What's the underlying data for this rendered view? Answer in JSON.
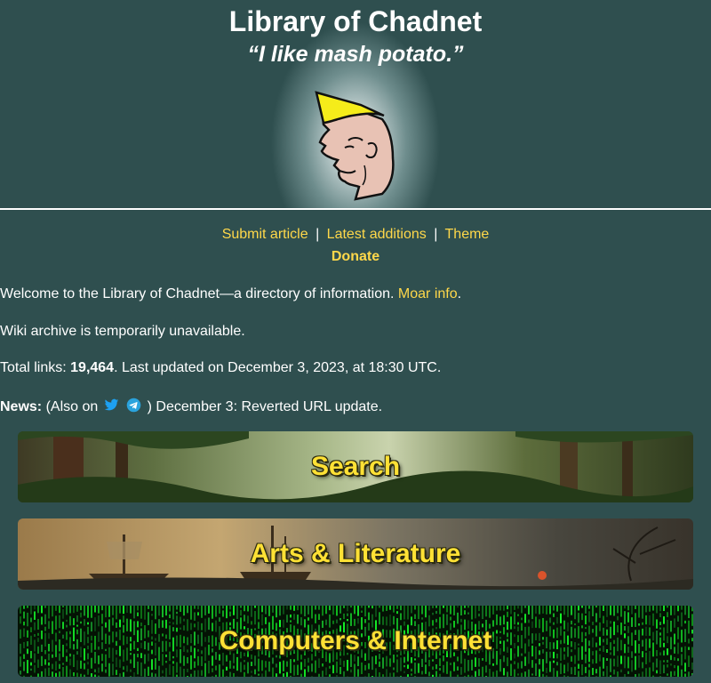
{
  "header": {
    "title": "Library of Chadnet",
    "tagline": "“I like mash potato.”"
  },
  "nav": {
    "submit": "Submit article",
    "latest": "Latest additions",
    "theme": "Theme",
    "separator": "|",
    "donate": "Donate"
  },
  "intro": {
    "welcome": "Welcome to the Library of Chadnet—a directory of information.",
    "moar": "Moar info",
    "period": "."
  },
  "wiki_notice": "Wiki archive is temporarily unavailable.",
  "stats": {
    "prefix": "Total links: ",
    "count": "19,464",
    "suffix": ". Last updated on December 3, 2023, at 18:30 UTC."
  },
  "news": {
    "label": "News:",
    "also_on": "(Also on",
    "close_paren": ")",
    "text": "December 3: Reverted URL update.",
    "icons": [
      "twitter-icon",
      "telegram-icon"
    ]
  },
  "categories": [
    {
      "label": "Search",
      "theme": "jungle"
    },
    {
      "label": "Arts & Literature",
      "theme": "ships"
    },
    {
      "label": "Computers & Internet",
      "theme": "matrix"
    }
  ],
  "colors": {
    "background": "#2f4f4f",
    "link": "#ffd84a",
    "banner_text": "#ffe135",
    "twitter": "#1da1f2",
    "telegram": "#2aa3dd"
  }
}
